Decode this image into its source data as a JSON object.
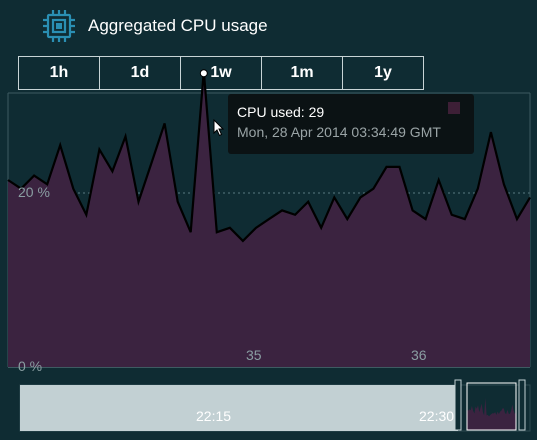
{
  "header": {
    "title": "Aggregated CPU usage",
    "icon": "cpu-chip-icon"
  },
  "range_tabs": [
    "1h",
    "1d",
    "1w",
    "1m",
    "1y"
  ],
  "tooltip": {
    "value_text": "CPU used: 29",
    "time_text": "Mon, 28 Apr 2014 03:34:49 GMT"
  },
  "colors": {
    "background": "#0f2c33",
    "area_fill": "#3b2340",
    "line": "#000000",
    "navigator": "#c2d0d3",
    "tooltip_bg": "#0b1214"
  },
  "chart_data": {
    "type": "area",
    "title": "Aggregated CPU usage",
    "ylabel": "",
    "xlabel": "",
    "ylim": [
      0,
      32.5
    ],
    "y_ticks": [
      "0 %",
      "20 %"
    ],
    "x_ticks": [
      "35",
      "36"
    ],
    "grid": true,
    "series": [
      {
        "values": [
          21.5,
          20.5,
          22,
          21,
          25.5,
          20.5,
          17.5,
          25,
          22.5,
          26.5,
          19,
          23.5,
          28,
          19,
          15.5,
          34,
          15.5,
          16,
          14.5,
          16,
          17,
          18,
          17.5,
          19,
          16,
          19.5,
          17,
          19.5,
          20.5,
          23,
          23,
          18,
          17,
          21.5,
          17.5,
          17,
          20.5,
          27,
          21,
          17,
          19.5
        ]
      }
    ],
    "highlighted_point": {
      "index": 15,
      "value": 29,
      "time": "Mon, 28 Apr 2014 03:34:49 GMT"
    },
    "navigator": {
      "ticks": [
        "22:15",
        "22:30"
      ]
    }
  }
}
